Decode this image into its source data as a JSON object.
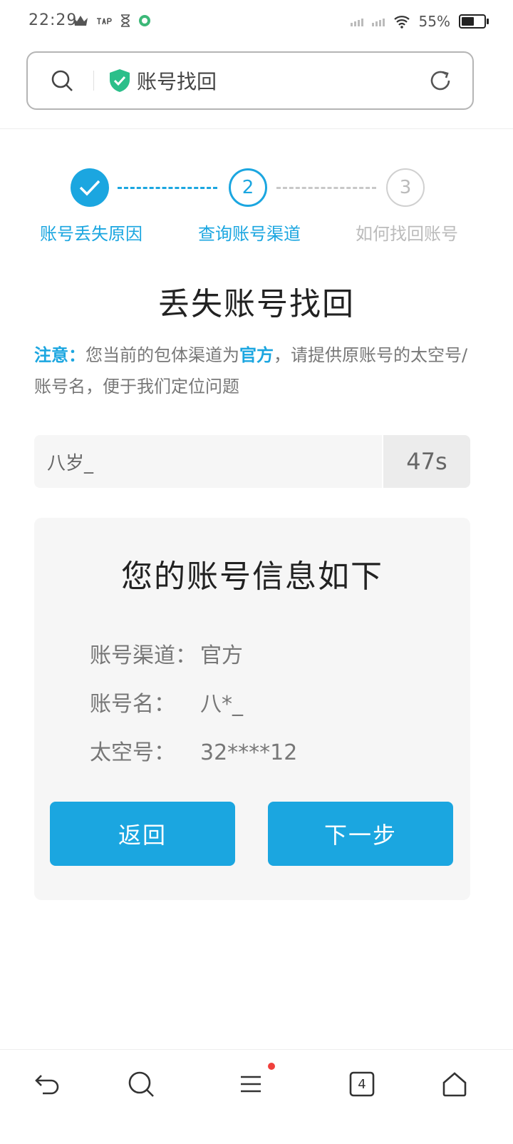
{
  "status_bar": {
    "time": "22:29",
    "battery_text": "55%",
    "battery_level": 0.55
  },
  "address_bar": {
    "title": "账号找回"
  },
  "steps": [
    {
      "number": "1",
      "label": "账号丢失原因",
      "state": "done"
    },
    {
      "number": "2",
      "label": "查询账号渠道",
      "state": "active"
    },
    {
      "number": "3",
      "label": "如何找回账号",
      "state": "pending"
    }
  ],
  "page_title": "丢失账号找回",
  "notice": {
    "prefix": "注意：",
    "text1": "您当前的包体渠道为",
    "channel": "官方",
    "text2": "，请提供原账号的太空号/账号名，便于我们定位问题"
  },
  "query": {
    "value": "八岁_",
    "timer": "47s"
  },
  "account_card": {
    "title": "您的账号信息如下",
    "rows": [
      {
        "label": "账号渠道：",
        "value": "官方"
      },
      {
        "label": "账号名：",
        "value": "八*_"
      },
      {
        "label": "太空号：",
        "value": "32****12"
      }
    ],
    "back_label": "返回",
    "next_label": "下一步"
  },
  "bottom_nav": {
    "tabs_count": "4"
  },
  "colors": {
    "accent": "#1ba6e0",
    "badge": "#f0403c"
  }
}
